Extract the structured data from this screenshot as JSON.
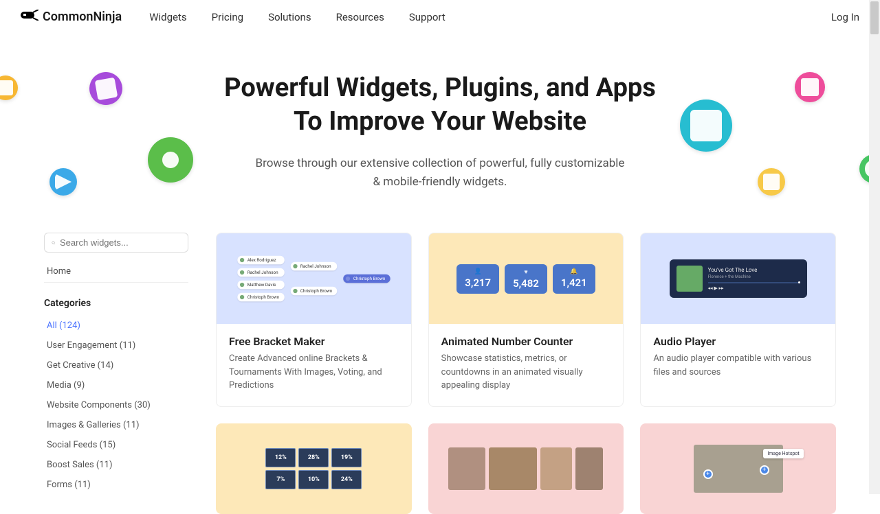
{
  "header": {
    "brand": "CommonNinja",
    "nav": [
      "Widgets",
      "Pricing",
      "Solutions",
      "Resources",
      "Support"
    ],
    "login": "Log In"
  },
  "hero": {
    "title_line1": "Powerful Widgets, Plugins, and Apps",
    "title_line2": "To Improve Your Website",
    "subtitle": "Browse through our extensive collection of powerful, fully customizable & mobile-friendly widgets."
  },
  "sidebar": {
    "search_placeholder": "Search widgets...",
    "home": "Home",
    "categories_label": "Categories",
    "categories": [
      "All (124)",
      "User Engagement (11)",
      "Get Creative (14)",
      "Media (9)",
      "Website Components (30)",
      "Images & Galleries (11)",
      "Social Feeds (15)",
      "Boost Sales (11)",
      "Forms (11)"
    ]
  },
  "cards": [
    {
      "title": "Free Bracket Maker",
      "desc": "Create Advanced online Brackets & Tournaments With Images, Voting, and Predictions"
    },
    {
      "title": "Animated Number Counter",
      "desc": "Showcase statistics, metrics, or countdowns in an animated visually appealing display"
    },
    {
      "title": "Audio Player",
      "desc": "An audio player compatible with various files and sources"
    }
  ],
  "mocks": {
    "bracket_names": [
      "Alex Rodriguez",
      "Rachel Johnson",
      "Matthew Davis",
      "Christoph Brown",
      "Rachel Johnson",
      "Christoph Brown",
      "Christoph Brown"
    ],
    "counters": [
      {
        "icon": "👤",
        "value": "3,217"
      },
      {
        "icon": "♥",
        "value": "5,482"
      },
      {
        "icon": "🔔",
        "value": "1,421"
      }
    ],
    "audio": {
      "title": "You've Got The Love",
      "subtitle": "Florence + the Machine"
    },
    "tiles": [
      "12%",
      "28%",
      "19%",
      "7%",
      "10%",
      "24%"
    ],
    "hotspot_label": "Image Hotspot"
  }
}
